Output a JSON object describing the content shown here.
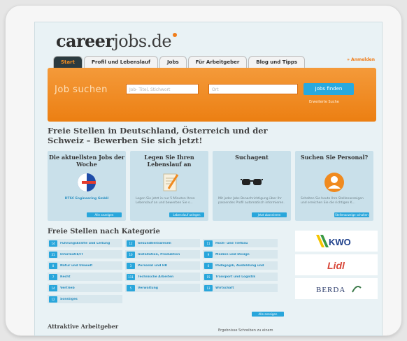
{
  "logo": {
    "bold": "career",
    "rest": "jobs.de"
  },
  "tabs": [
    "Start",
    "Profil und Lebenslauf",
    "Jobs",
    "Für Arbeitgeber",
    "Blog und Tipps"
  ],
  "top_right": "» Anmelden",
  "search": {
    "label": "Job suchen",
    "what_placeholder": "Job- Titel, Stichwort",
    "where_placeholder": "Ort",
    "button": "Jobs finden",
    "small": "Erweiterte Suche"
  },
  "headline": "Freie Stellen in Deutschland, Österreich und der Schweiz – Bewerben Sie sich jetzt!",
  "boxes": [
    {
      "title": "Die aktuellsten Jobs der Woche",
      "desc": "DTSC Engineering GmbH",
      "button": "Alle anzeigen"
    },
    {
      "title": "Legen Sie Ihren Lebenslauf an",
      "desc": "Legen Sie jetzt in nur 5 Minuten Ihren Lebenslauf an und bewerben Sie s...",
      "button": "Lebenslauf anlegen"
    },
    {
      "title": "Suchagent",
      "desc": "Mit jeder Jobs Benachrichtigung über Ihr passendes Profil automatisch informieren.",
      "button": "Jetzt abonnieren"
    },
    {
      "title": "Suchen Sie Personal?",
      "desc": "Schalten Sie heute Ihre Stellenanzeigen und erreichen Sie die richtigen K...",
      "button": "Stellenanzeige schalten"
    }
  ],
  "categories_title": "Freie Stellen nach Kategorie",
  "categories": [
    [
      {
        "n": "14",
        "t": "Führungskräfte und Leitung"
      },
      {
        "n": "12",
        "t": "Gesundheitswesen"
      },
      {
        "n": "11",
        "t": "Hoch- und Tiefbau"
      }
    ],
    [
      {
        "n": "31",
        "t": "Informatik/IT"
      },
      {
        "n": "10",
        "t": "Installation, Produktion"
      },
      {
        "n": "9",
        "t": "Medien und Design"
      }
    ],
    [
      {
        "n": "8",
        "t": "Natur und Umwelt"
      },
      {
        "n": "3",
        "t": "Personal und HR"
      },
      {
        "n": "6",
        "t": "Pädagogik, Ausbildung und"
      }
    ],
    [
      {
        "n": "7",
        "t": "Recht"
      },
      {
        "n": "111",
        "t": "Technische Arbeiten"
      },
      {
        "n": "15",
        "t": "Transport und Logistik"
      }
    ],
    [
      {
        "n": "14",
        "t": "Vertrieb"
      },
      {
        "n": "5",
        "t": "Verwaltung"
      },
      {
        "n": "13",
        "t": "Wirtschaft"
      }
    ],
    [
      {
        "n": "12",
        "t": "Sonstiges"
      }
    ]
  ],
  "more_button": "Alle anzeigen",
  "employer_logos": [
    "KWO",
    "Lidl",
    "BERDA"
  ],
  "bottom_left": "Attraktive Arbeitgeber",
  "bottom_right": "Ergebnisse Schreiben zu einem",
  "colors": {
    "accent": "#f08a1f",
    "blue": "#29a6db",
    "dark_tab": "#2b3a3f"
  }
}
